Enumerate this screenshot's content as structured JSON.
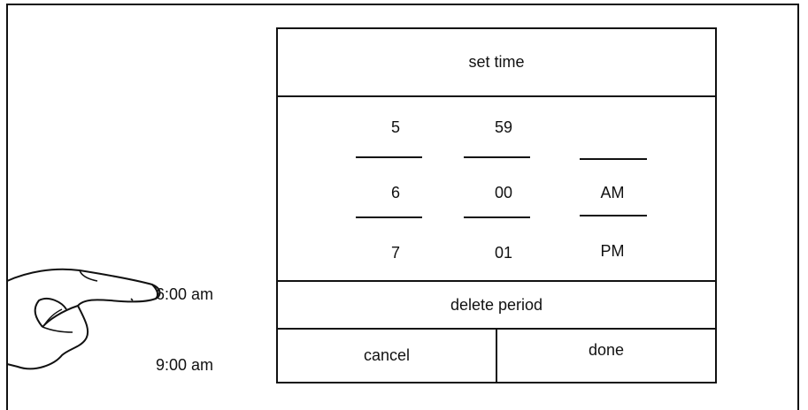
{
  "schedule": {
    "times": [
      "6:00 am",
      "9:00 am"
    ]
  },
  "dialog": {
    "title": "set time",
    "hours": [
      "5",
      "6",
      "7"
    ],
    "minutes": [
      "59",
      "00",
      "01"
    ],
    "period": [
      "",
      "AM",
      "PM"
    ],
    "delete_label": "delete period",
    "cancel_label": "cancel",
    "done_label": "done"
  }
}
